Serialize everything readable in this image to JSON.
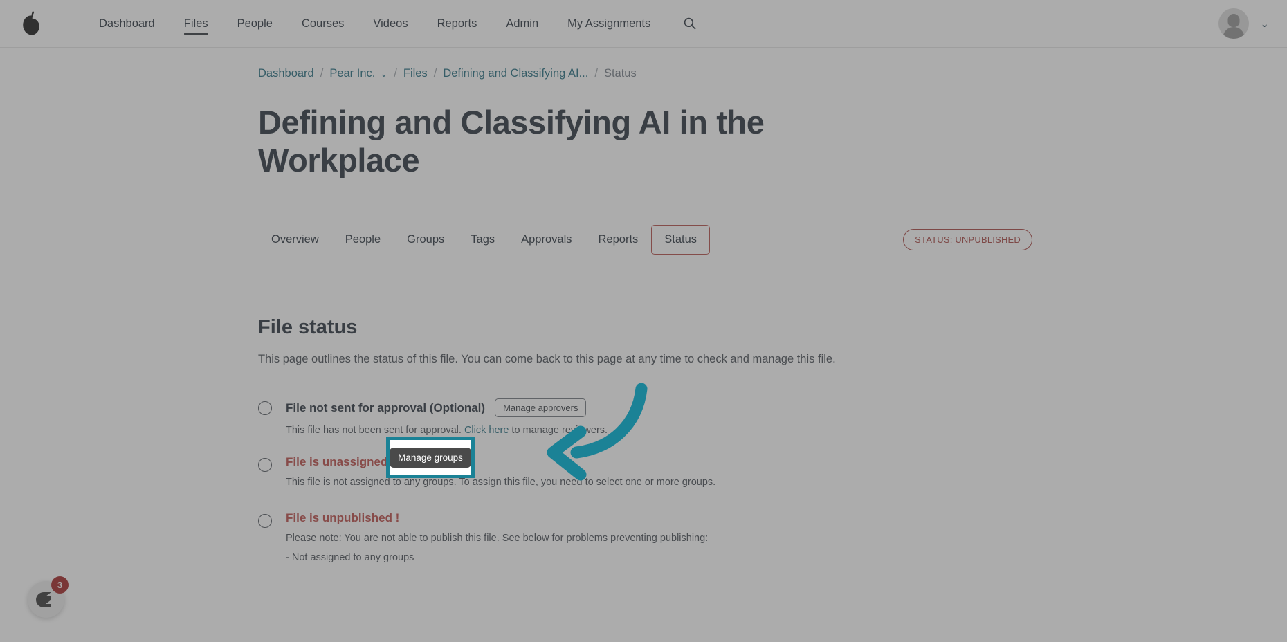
{
  "topnav": {
    "logo_icon": "pear-logo-icon",
    "items": [
      {
        "label": "Dashboard",
        "active": false
      },
      {
        "label": "Files",
        "active": true
      },
      {
        "label": "People",
        "active": false
      },
      {
        "label": "Courses",
        "active": false
      },
      {
        "label": "Videos",
        "active": false
      },
      {
        "label": "Reports",
        "active": false
      },
      {
        "label": "Admin",
        "active": false
      },
      {
        "label": "My Assignments",
        "active": false
      }
    ],
    "search_icon": "search-icon",
    "avatar_icon": "user-avatar-icon",
    "caret": "⌄"
  },
  "breadcrumb": {
    "sep": "/",
    "caret": "⌄",
    "items": [
      {
        "label": "Dashboard",
        "current": false,
        "has_caret": false
      },
      {
        "label": "Pear Inc.",
        "current": false,
        "has_caret": true
      },
      {
        "label": "Files",
        "current": false,
        "has_caret": false
      },
      {
        "label": "Defining and Classifying AI...",
        "current": false,
        "has_caret": false
      },
      {
        "label": "Status",
        "current": true,
        "has_caret": false
      }
    ]
  },
  "page": {
    "title": "Defining and Classifying AI in the Workplace",
    "status_badge": "STATUS: UNPUBLISHED"
  },
  "tabs": [
    {
      "label": "Overview",
      "active": false
    },
    {
      "label": "People",
      "active": false
    },
    {
      "label": "Groups",
      "active": false
    },
    {
      "label": "Tags",
      "active": false
    },
    {
      "label": "Approvals",
      "active": false
    },
    {
      "label": "Reports",
      "active": false
    },
    {
      "label": "Status",
      "active": true
    }
  ],
  "section": {
    "heading": "File status",
    "description": "This page outlines the status of this file. You can come back to this page at any time to check and manage this file."
  },
  "status_items": [
    {
      "title": "File not sent for approval (Optional)",
      "danger": false,
      "button": "Manage approvers",
      "desc_before": "This file has not been sent for approval. ",
      "desc_link": "Click here",
      "desc_after": " to manage reviewers.",
      "extra": ""
    },
    {
      "title": "File is unassigned",
      "danger": true,
      "button": "",
      "desc_before": "This file is not assigned to any groups. To assign this file, you need to select one or more groups.",
      "desc_link": "",
      "desc_after": "",
      "extra": ""
    },
    {
      "title": "File is unpublished !",
      "danger": true,
      "button": "",
      "desc_before": "Please note: You are not able to publish this file. See below for problems preventing publishing:",
      "desc_link": "",
      "desc_after": "",
      "extra": "- Not assigned to any groups"
    }
  ],
  "annotation": {
    "tooltip_label": "Manage groups",
    "highlight_color": "#1b8296",
    "arrow_color": "#1b8296",
    "arrow_icon": "curved-left-arrow-icon"
  },
  "chat_widget": {
    "icon": "chat-bubble-icon",
    "badge_count": "3"
  }
}
